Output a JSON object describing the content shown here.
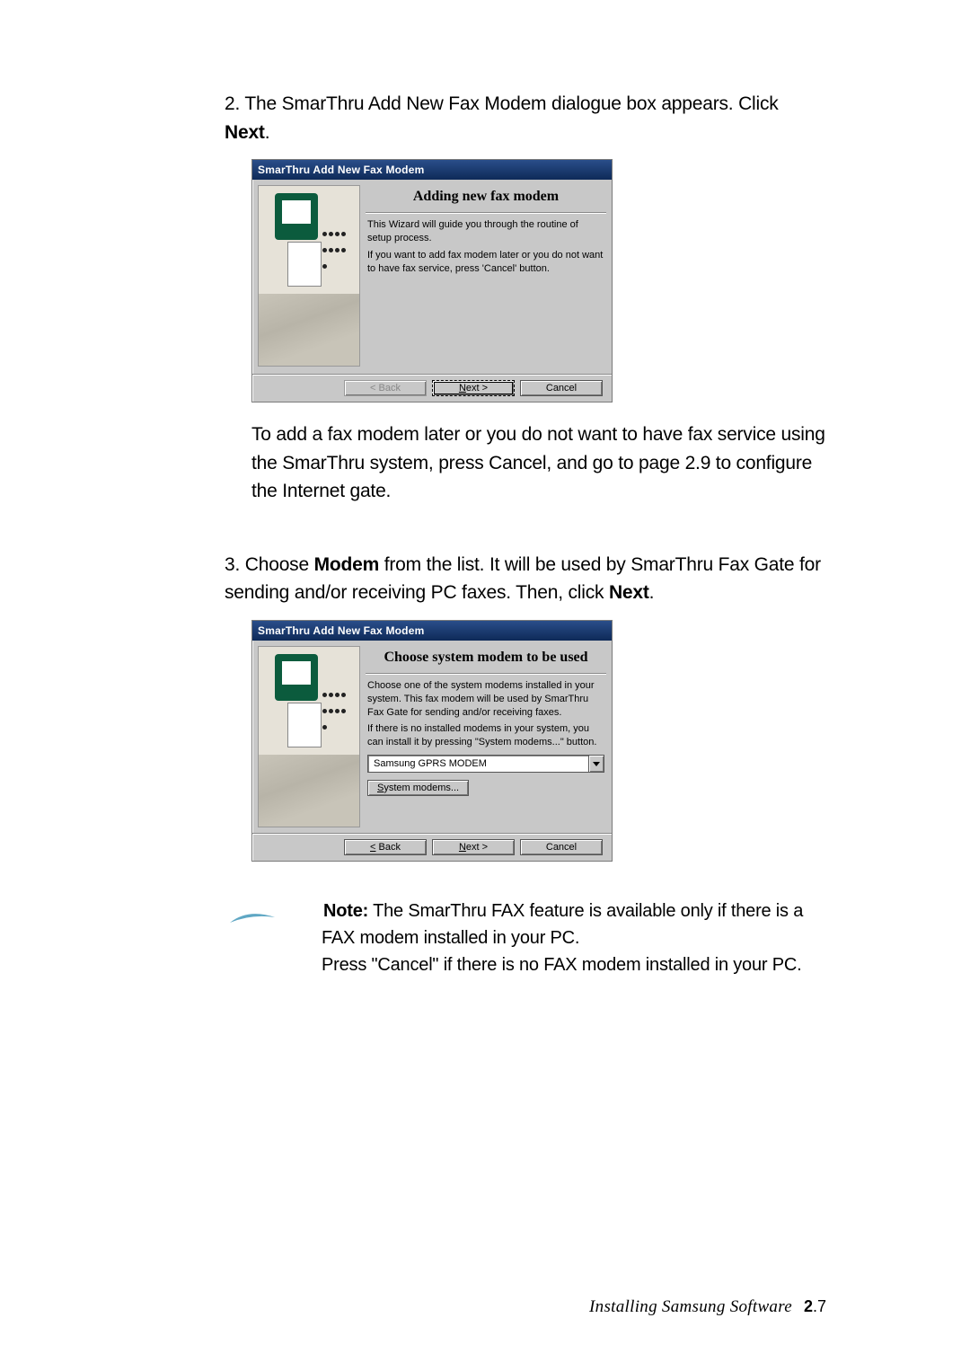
{
  "step2": {
    "num": "2.",
    "text_a": "The SmarThru Add New Fax Modem dialogue box appears. Click ",
    "text_b": "Next",
    "text_c": "."
  },
  "dialog1": {
    "title": "SmarThru Add New Fax Modem",
    "heading": "Adding new fax modem",
    "p1": "This Wizard will guide you through the routine of setup process.",
    "p2": "If you want to add fax modem later or you do not want to have fax service, press 'Cancel' button.",
    "buttons": {
      "back": "< Back",
      "next": "Next >",
      "cancel": "Cancel"
    }
  },
  "para1": "To add a fax modem later or you do not want to have fax service using the SmarThru system, press Cancel, and go to page 2.9 to configure the Internet gate.",
  "step3": {
    "num": "3.",
    "text_a": "Choose ",
    "text_b": "Modem",
    "text_c": " from the list. It will be used by SmarThru Fax Gate for sending and/or receiving PC faxes. Then, click ",
    "text_d": "Next",
    "text_e": "."
  },
  "dialog2": {
    "title": "SmarThru Add New Fax Modem",
    "heading": "Choose system modem to be used",
    "p1": "Choose one of the system modems installed in your system. This fax modem will be used by SmarThru Fax Gate for sending and/or receiving faxes.",
    "p2": "If there is no installed modems in your system, you can install it by pressing \"System modems...\" button.",
    "combo": "Samsung GPRS MODEM",
    "sysbtn": "System modems...",
    "buttons": {
      "back": "< Back",
      "next": "Next >",
      "cancel": "Cancel"
    }
  },
  "note": {
    "label": "Note:",
    "l1": " The SmarThru FAX feature is available only if there is a FAX modem installed in your PC.",
    "l2": "Press \"Cancel\" if there is no FAX modem installed in your PC."
  },
  "footer": {
    "section": "Installing Samsung Software",
    "chapter": "2",
    "page": ".7"
  }
}
